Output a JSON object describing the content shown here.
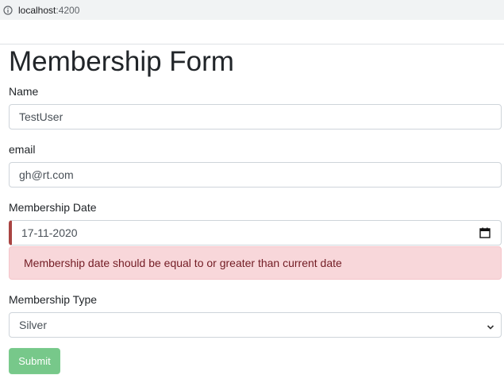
{
  "browser": {
    "url_host": "localhost",
    "url_port": ":4200",
    "info_icon": "info-icon"
  },
  "form": {
    "title": "Membership Form",
    "name": {
      "label": "Name",
      "value": "TestUser"
    },
    "email": {
      "label": "email",
      "value": "gh@rt.com"
    },
    "membership_date": {
      "label": "Membership Date",
      "value": "17-11-2020",
      "icon": "calendar-icon",
      "error": "Membership date should be equal to or greater than current date"
    },
    "membership_type": {
      "label": "Membership Type",
      "selected": "Silver",
      "icon": "chevron-down-icon"
    },
    "submit_label": "Submit"
  },
  "colors": {
    "error_bg": "#f8d7da",
    "error_text": "#721c24",
    "invalid_border": "#a94442",
    "submit_bg": "#77c88a"
  }
}
